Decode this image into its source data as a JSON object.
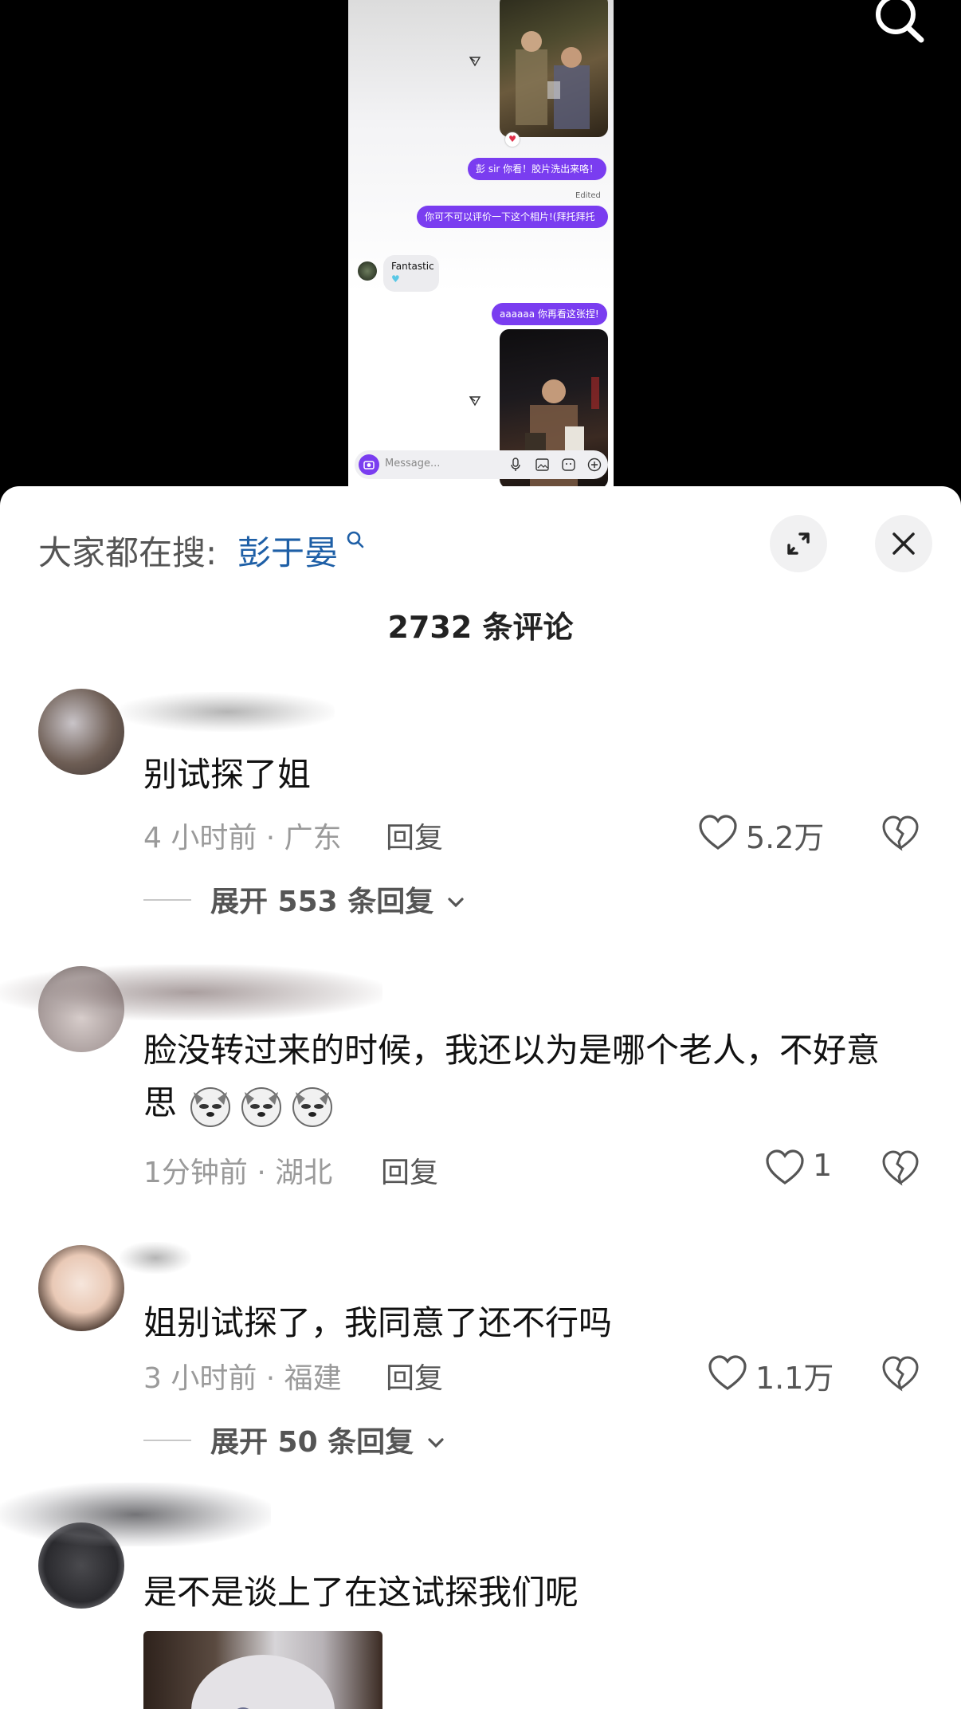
{
  "video": {
    "chat": {
      "bubble1": "彭 sir 你看！胶片洗出来咯！",
      "edited": "Edited",
      "bubble2": "你可不可以评价一下这个相片!(拜托拜托",
      "reply_text": "Fantastic",
      "bubble3": "aaaaaa 你再看这张捏!",
      "message_placeholder": "Message..."
    }
  },
  "sheet": {
    "search_prefix": "大家都在搜:",
    "search_term": "彭于晏",
    "comment_count": "2732 条评论",
    "reply_label": "回复",
    "comments": [
      {
        "text": "别试探了姐",
        "time_location": "4 小时前 · 广东",
        "likes": "5.2万",
        "expand": "展开 553 条回复"
      },
      {
        "text_line1": "脸没转过来的时候，我还以为是哪个老人，不好意",
        "text_line2": "思",
        "time_location": "1分钟前 · 湖北",
        "likes": "1"
      },
      {
        "text": "姐别试探了，我同意了还不行吗",
        "time_location": "3 小时前 · 福建",
        "likes": "1.1万",
        "expand": "展开 50 条回复"
      },
      {
        "text": "是不是谈上了在这试探我们呢"
      }
    ]
  },
  "colors": {
    "accent_link": "#1e5fa6",
    "chat_bubble": "#7a3df0"
  },
  "icons": [
    "search-icon",
    "expand-icon",
    "close-icon",
    "heart-icon",
    "broken-heart-icon",
    "chevron-down-icon"
  ]
}
